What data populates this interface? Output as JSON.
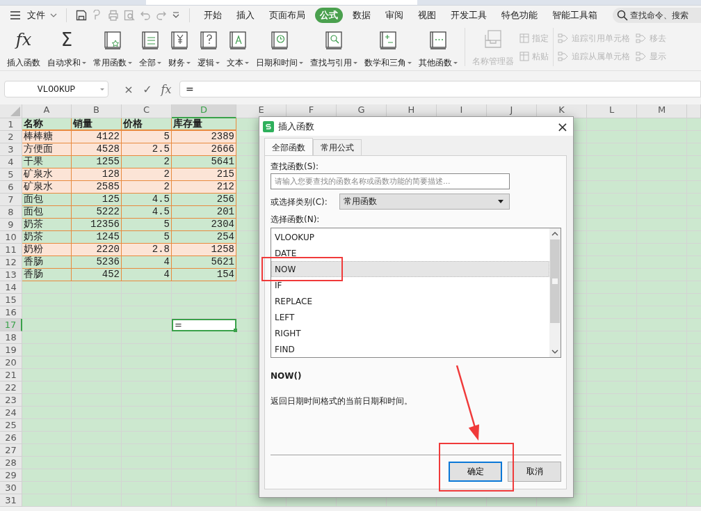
{
  "menu_bar": {
    "file_menu": "文件",
    "tabs": [
      {
        "label": "开始",
        "selected": false
      },
      {
        "label": "插入",
        "selected": false
      },
      {
        "label": "页面布局",
        "selected": false
      },
      {
        "label": "公式",
        "selected": true
      },
      {
        "label": "数据",
        "selected": false
      },
      {
        "label": "审阅",
        "selected": false
      },
      {
        "label": "视图",
        "selected": false
      },
      {
        "label": "开发工具",
        "selected": false
      },
      {
        "label": "特色功能",
        "selected": false
      },
      {
        "label": "智能工具箱",
        "selected": false
      }
    ],
    "search": {
      "placeholder": "查找命令、搜索"
    }
  },
  "ribbon": {
    "functions": [
      {
        "label": "插入函数",
        "dropdown": false,
        "glyph": "fx"
      },
      {
        "label": "自动求和",
        "dropdown": true,
        "glyph": "Σ"
      },
      {
        "label": "常用函数",
        "dropdown": true
      },
      {
        "label": "全部",
        "dropdown": true
      },
      {
        "label": "财务",
        "dropdown": true
      },
      {
        "label": "逻辑",
        "dropdown": true
      },
      {
        "label": "文本",
        "dropdown": true
      },
      {
        "label": "日期和时间",
        "dropdown": true
      },
      {
        "label": "查找与引用",
        "dropdown": true
      },
      {
        "label": "数学和三角",
        "dropdown": true
      },
      {
        "label": "其他函数",
        "dropdown": true
      }
    ],
    "names": [
      {
        "label": "名称管理器",
        "disabled": true
      },
      {
        "label": "指定",
        "disabled": true
      },
      {
        "label": "粘贴",
        "disabled": true
      }
    ],
    "auditing": [
      {
        "label": "追踪引用单元格",
        "disabled": true
      },
      {
        "label": "移去",
        "disabled": true
      },
      {
        "label": "追踪从属单元格",
        "disabled": true
      },
      {
        "label": "显示",
        "disabled": true
      }
    ]
  },
  "formula_bar": {
    "name_box": "VLOOKUP",
    "cancel": "×",
    "confirm": "✓",
    "fx": "fx",
    "formula": "="
  },
  "sheet": {
    "columns": [
      {
        "label": "A",
        "selected": false
      },
      {
        "label": "B",
        "selected": false
      },
      {
        "label": "C",
        "selected": false
      },
      {
        "label": "D",
        "selected": true
      },
      {
        "label": "E",
        "selected": false
      },
      {
        "label": "F",
        "selected": false
      },
      {
        "label": "G",
        "selected": false
      },
      {
        "label": "H",
        "selected": false
      },
      {
        "label": "I",
        "selected": false
      },
      {
        "label": "J",
        "selected": false
      },
      {
        "label": "K",
        "selected": false
      },
      {
        "label": "L",
        "selected": false
      },
      {
        "label": "M",
        "selected": false
      }
    ],
    "row_headers": [
      {
        "label": "1",
        "selected": false
      },
      {
        "label": "2",
        "selected": false
      },
      {
        "label": "3",
        "selected": false
      },
      {
        "label": "4",
        "selected": false
      },
      {
        "label": "5",
        "selected": false
      },
      {
        "label": "6",
        "selected": false
      },
      {
        "label": "7",
        "selected": false
      },
      {
        "label": "8",
        "selected": false
      },
      {
        "label": "9",
        "selected": false
      },
      {
        "label": "10",
        "selected": false
      },
      {
        "label": "11",
        "selected": false
      },
      {
        "label": "12",
        "selected": false
      },
      {
        "label": "13",
        "selected": false
      },
      {
        "label": "14",
        "selected": false
      },
      {
        "label": "15",
        "selected": false
      },
      {
        "label": "16",
        "selected": false
      },
      {
        "label": "17",
        "selected": true
      },
      {
        "label": "18",
        "selected": false
      },
      {
        "label": "19",
        "selected": false
      },
      {
        "label": "20",
        "selected": false
      },
      {
        "label": "21",
        "selected": false
      },
      {
        "label": "22",
        "selected": false
      },
      {
        "label": "23",
        "selected": false
      },
      {
        "label": "24",
        "selected": false
      },
      {
        "label": "25",
        "selected": false
      },
      {
        "label": "26",
        "selected": false
      },
      {
        "label": "27",
        "selected": false
      },
      {
        "label": "28",
        "selected": false
      },
      {
        "label": "29",
        "selected": false
      },
      {
        "label": "30",
        "selected": false
      },
      {
        "label": "31",
        "selected": false
      }
    ],
    "rows": [
      {
        "kind": "header",
        "color": "#cce8cf",
        "cells": [
          "名称",
          "销量",
          "价格",
          "库存量"
        ]
      },
      {
        "kind": "data",
        "color": "#fce4d6",
        "cells": [
          "棒棒糖",
          "4122",
          "5",
          "2389"
        ]
      },
      {
        "kind": "data",
        "color": "#fce4d6",
        "cells": [
          "方便面",
          "4528",
          "2.5",
          "2666"
        ]
      },
      {
        "kind": "data",
        "color": "#cce8cf",
        "cells": [
          "干果",
          "1255",
          "2",
          "5641"
        ]
      },
      {
        "kind": "data",
        "color": "#fce4d6",
        "cells": [
          "矿泉水",
          "128",
          "2",
          "215"
        ]
      },
      {
        "kind": "data",
        "color": "#fce4d6",
        "cells": [
          "矿泉水",
          "2585",
          "2",
          "212"
        ]
      },
      {
        "kind": "data",
        "color": "#cce8cf",
        "cells": [
          "面包",
          "125",
          "4.5",
          "256"
        ]
      },
      {
        "kind": "data",
        "color": "#cce8cf",
        "cells": [
          "面包",
          "5222",
          "4.5",
          "201"
        ]
      },
      {
        "kind": "data",
        "color": "#cce8cf",
        "cells": [
          "奶茶",
          "12356",
          "5",
          "2304"
        ]
      },
      {
        "kind": "data",
        "color": "#cce8cf",
        "cells": [
          "奶茶",
          "1245",
          "5",
          "254"
        ]
      },
      {
        "kind": "data",
        "color": "#fce4d6",
        "cells": [
          "奶粉",
          "2220",
          "2.8",
          "1258"
        ]
      },
      {
        "kind": "data",
        "color": "#cce8cf",
        "cells": [
          "香肠",
          "5236",
          "4",
          "5621"
        ]
      },
      {
        "kind": "data",
        "color": "#cce8cf",
        "cells": [
          "香肠",
          "452",
          "4",
          "154"
        ]
      }
    ],
    "active_cell": {
      "value": "="
    }
  },
  "dialog": {
    "title": "插入函数",
    "close": "×",
    "tabs": [
      {
        "label": "全部函数",
        "selected": true
      },
      {
        "label": "常用公式",
        "selected": false
      }
    ],
    "search_label": "查找函数(S):",
    "search": {
      "placeholder": "请输入您要查找的函数名称或函数功能的简要描述..."
    },
    "category_label": "或选择类别(C):",
    "category": "常用函数",
    "list_label": "选择函数(N):",
    "functions": [
      {
        "name": "VLOOKUP",
        "selected": false
      },
      {
        "name": "DATE",
        "selected": false
      },
      {
        "name": "NOW",
        "selected": true
      },
      {
        "name": "IF",
        "selected": false
      },
      {
        "name": "REPLACE",
        "selected": false
      },
      {
        "name": "LEFT",
        "selected": false
      },
      {
        "name": "RIGHT",
        "selected": false
      },
      {
        "name": "FIND",
        "selected": false
      }
    ],
    "signature": "NOW()",
    "description": "返回日期时间格式的当前日期和时间。",
    "buttons": [
      {
        "label": "确定",
        "focused": true
      },
      {
        "label": "取消",
        "focused": false
      }
    ]
  }
}
